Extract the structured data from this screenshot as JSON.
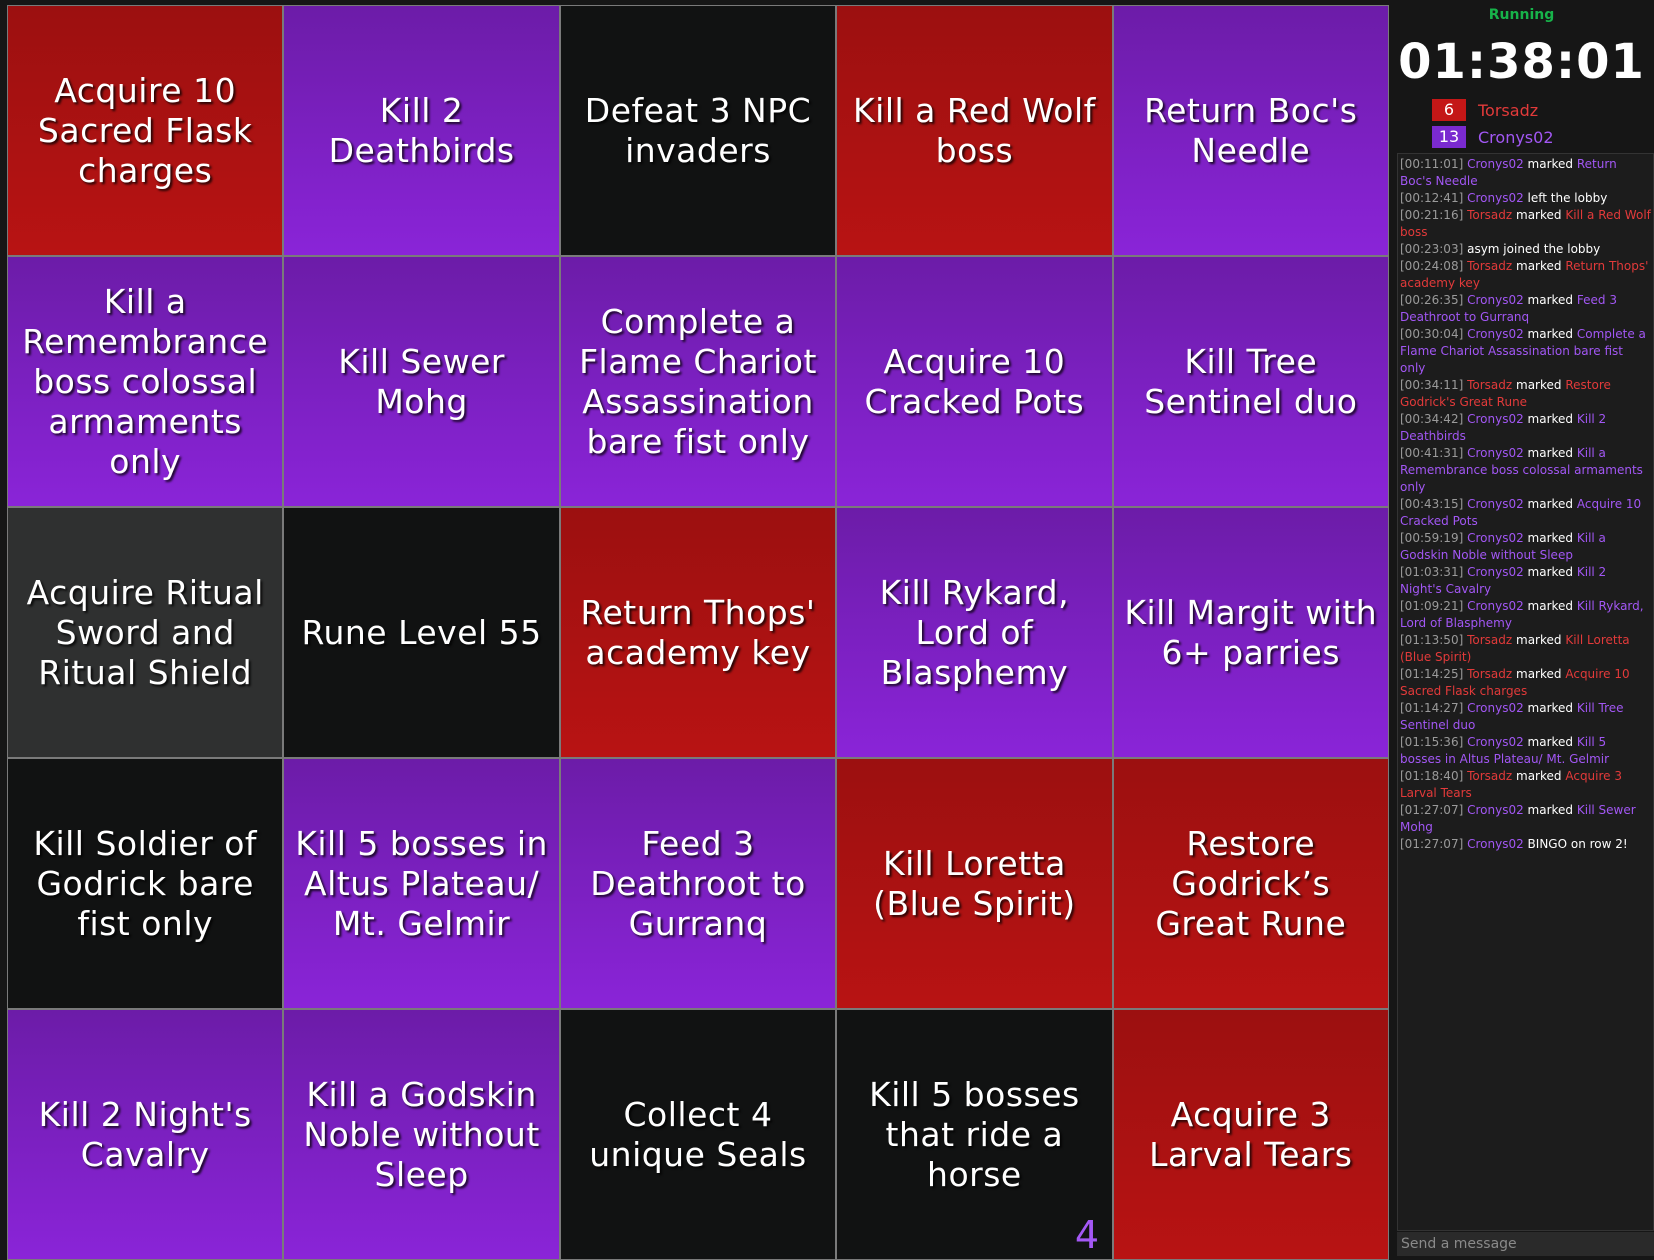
{
  "colors": {
    "red": "#b31313",
    "purple": "#8a24d8",
    "black": "#111212",
    "gray": "#2f3030",
    "status_green": "#17b34a"
  },
  "board": {
    "cells": [
      {
        "text": "Acquire 10 Sacred Flask charges",
        "color": "red"
      },
      {
        "text": "Kill 2 Deathbirds",
        "color": "purple"
      },
      {
        "text": "Defeat 3 NPC invaders",
        "color": "black"
      },
      {
        "text": "Kill a Red Wolf boss",
        "color": "red"
      },
      {
        "text": "Return Boc's Needle",
        "color": "purple"
      },
      {
        "text": "Kill a Remembrance boss colossal armaments only",
        "color": "purple"
      },
      {
        "text": "Kill Sewer Mohg",
        "color": "purple"
      },
      {
        "text": "Complete a Flame Chariot Assassination bare fist only",
        "color": "purple"
      },
      {
        "text": "Acquire 10 Cracked Pots",
        "color": "purple"
      },
      {
        "text": "Kill Tree Sentinel duo",
        "color": "purple"
      },
      {
        "text": "Acquire Ritual Sword and Ritual Shield",
        "color": "gray"
      },
      {
        "text": "Rune Level 55",
        "color": "black"
      },
      {
        "text": "Return Thops' academy key",
        "color": "red"
      },
      {
        "text": "Kill Rykard, Lord of Blasphemy",
        "color": "purple"
      },
      {
        "text": "Kill Margit with 6+ parries",
        "color": "purple"
      },
      {
        "text": "Kill Soldier of Godrick bare fist only",
        "color": "black"
      },
      {
        "text": "Kill 5 bosses in Altus Plateau/ Mt. Gelmir",
        "color": "purple"
      },
      {
        "text": "Feed 3 Deathroot to Gurranq",
        "color": "purple"
      },
      {
        "text": "Kill Loretta (Blue Spirit)",
        "color": "red"
      },
      {
        "text": "Restore Godrick’s Great Rune",
        "color": "red"
      },
      {
        "text": "Kill 2 Night's Cavalry",
        "color": "purple"
      },
      {
        "text": "Kill a Godskin Noble without Sleep",
        "color": "purple"
      },
      {
        "text": "Collect 4 unique Seals",
        "color": "black"
      },
      {
        "text": "Kill 5 bosses that ride a horse",
        "color": "black",
        "counter": "4"
      },
      {
        "text": "Acquire 3 Larval Tears",
        "color": "red"
      }
    ]
  },
  "status": "Running",
  "timer": "01:38:01",
  "players": [
    {
      "score": "6",
      "name": "Torsadz",
      "color": "#c41717",
      "text_color": "#e23a3a"
    },
    {
      "score": "13",
      "name": "Cronys02",
      "color": "#7a2ad0",
      "text_color": "#a257f4"
    }
  ],
  "log": [
    {
      "time": "[00:11:01]",
      "user": "Cronys02",
      "action": "marked",
      "goal": "Return Boc's Needle",
      "color": "purple"
    },
    {
      "time": "[00:12:41]",
      "user": "Cronys02",
      "action": "left the lobby",
      "goal": "",
      "color": "purple"
    },
    {
      "time": "[00:21:16]",
      "user": "Torsadz",
      "action": "marked",
      "goal": "Kill a Red Wolf boss",
      "color": "red"
    },
    {
      "time": "[00:23:03]",
      "user": "",
      "action": "asym joined the lobby",
      "goal": "",
      "color": ""
    },
    {
      "time": "[00:24:08]",
      "user": "Torsadz",
      "action": "marked",
      "goal": "Return Thops' academy key",
      "color": "red"
    },
    {
      "time": "[00:26:35]",
      "user": "Cronys02",
      "action": "marked",
      "goal": "Feed 3 Deathroot to Gurranq",
      "color": "purple"
    },
    {
      "time": "[00:30:04]",
      "user": "Cronys02",
      "action": "marked",
      "goal": "Complete a Flame Chariot Assassination bare fist only",
      "color": "purple"
    },
    {
      "time": "[00:34:11]",
      "user": "Torsadz",
      "action": "marked",
      "goal": "Restore Godrick's Great Rune",
      "color": "red"
    },
    {
      "time": "[00:34:42]",
      "user": "Cronys02",
      "action": "marked",
      "goal": "Kill 2 Deathbirds",
      "color": "purple"
    },
    {
      "time": "[00:41:31]",
      "user": "Cronys02",
      "action": "marked",
      "goal": "Kill a Remembrance boss colossal armaments only",
      "color": "purple"
    },
    {
      "time": "[00:43:15]",
      "user": "Cronys02",
      "action": "marked",
      "goal": "Acquire 10 Cracked Pots",
      "color": "purple"
    },
    {
      "time": "[00:59:19]",
      "user": "Cronys02",
      "action": "marked",
      "goal": "Kill a Godskin Noble without Sleep",
      "color": "purple"
    },
    {
      "time": "[01:03:31]",
      "user": "Cronys02",
      "action": "marked",
      "goal": "Kill 2 Night's Cavalry",
      "color": "purple"
    },
    {
      "time": "[01:09:21]",
      "user": "Cronys02",
      "action": "marked",
      "goal": "Kill Rykard, Lord of Blasphemy",
      "color": "purple"
    },
    {
      "time": "[01:13:50]",
      "user": "Torsadz",
      "action": "marked",
      "goal": "Kill Loretta (Blue Spirit)",
      "color": "red"
    },
    {
      "time": "[01:14:25]",
      "user": "Torsadz",
      "action": "marked",
      "goal": "Acquire 10 Sacred Flask charges",
      "color": "red"
    },
    {
      "time": "[01:14:27]",
      "user": "Cronys02",
      "action": "marked",
      "goal": "Kill Tree Sentinel duo",
      "color": "purple"
    },
    {
      "time": "[01:15:36]",
      "user": "Cronys02",
      "action": "marked",
      "goal": "Kill 5 bosses in Altus Plateau/ Mt. Gelmir",
      "color": "purple"
    },
    {
      "time": "[01:18:40]",
      "user": "Torsadz",
      "action": "marked",
      "goal": "Acquire 3 Larval Tears",
      "color": "red"
    },
    {
      "time": "[01:27:07]",
      "user": "Cronys02",
      "action": "marked",
      "goal": "Kill Sewer Mohg",
      "color": "purple"
    },
    {
      "time": "[01:27:07]",
      "user": "Cronys02",
      "action": "BINGO on row 2!",
      "goal": "",
      "color": "purple"
    }
  ],
  "chat": {
    "placeholder": "Send a message"
  }
}
